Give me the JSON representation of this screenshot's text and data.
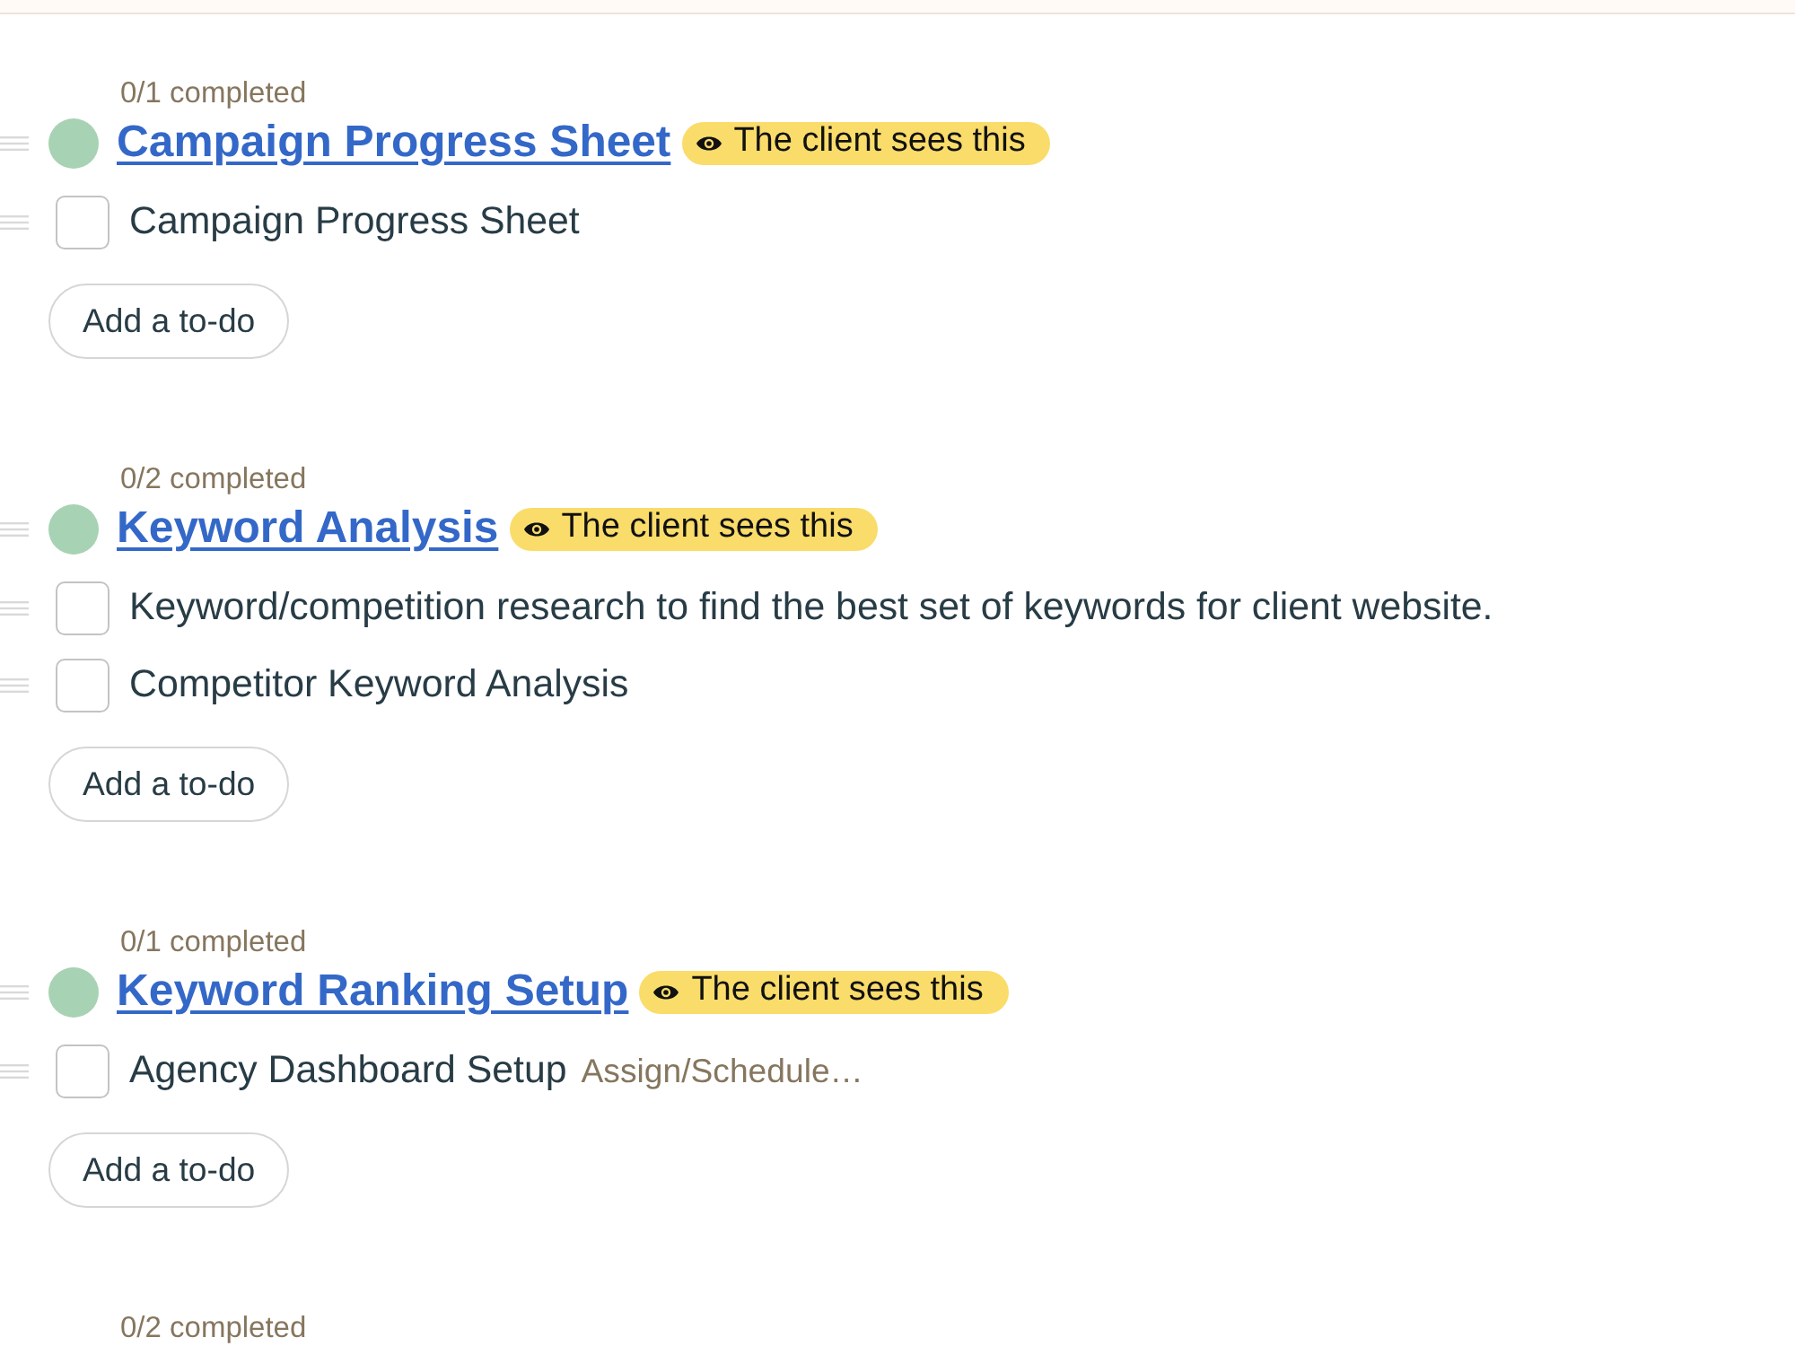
{
  "lists": [
    {
      "progress": "0/1 completed",
      "title": "Campaign Progress Sheet",
      "badge": "The client sees this",
      "todos": [
        {
          "text": "Campaign Progress Sheet",
          "checked": false
        }
      ],
      "add_button": "Add a to-do"
    },
    {
      "progress": "0/2 completed",
      "title": "Keyword Analysis",
      "badge": "The client sees this",
      "todos": [
        {
          "text": "Keyword/competition research to find the best set of keywords for client website.",
          "checked": false
        },
        {
          "text": "Competitor Keyword Analysis",
          "checked": false
        }
      ],
      "add_button": "Add a to-do"
    },
    {
      "progress": "0/1 completed",
      "title": "Keyword Ranking Setup",
      "badge": "The client sees this",
      "todos": [
        {
          "text": "Agency Dashboard Setup",
          "checked": false,
          "assign": "Assign/Schedule…"
        }
      ],
      "add_button": "Add a to-do"
    },
    {
      "progress": "0/2 completed"
    }
  ]
}
